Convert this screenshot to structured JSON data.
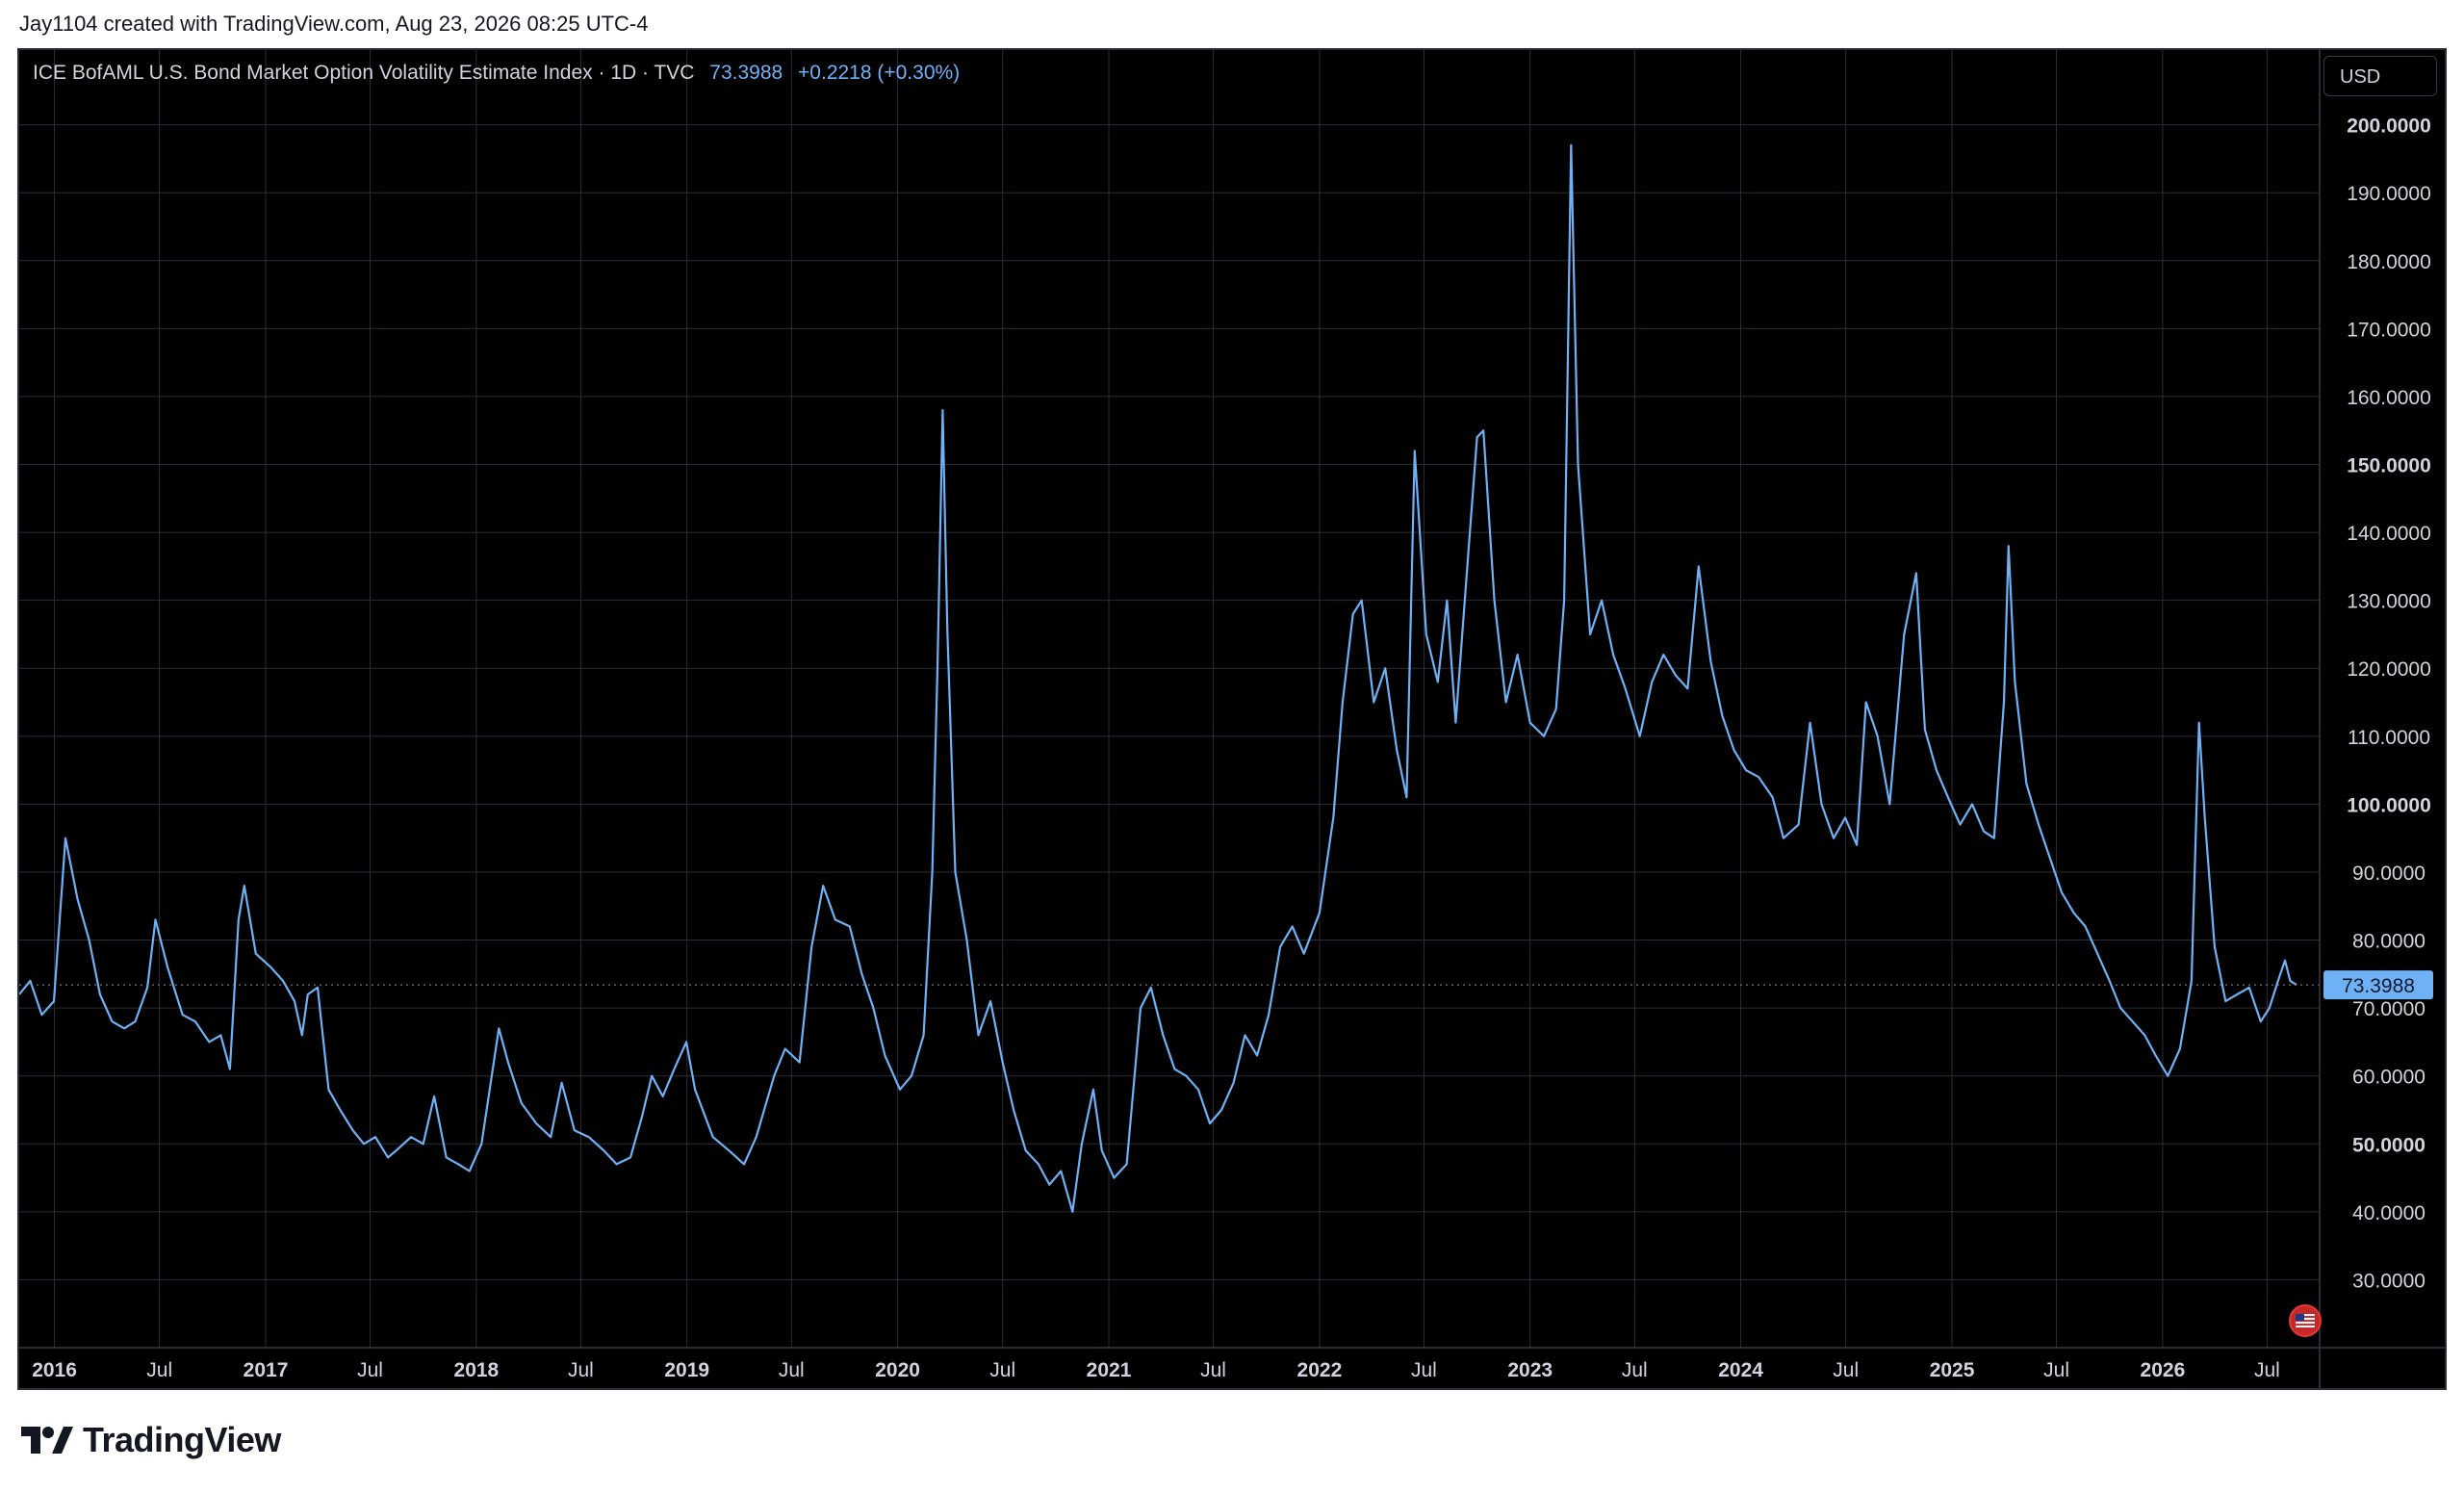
{
  "attribution": "Jay1104 created with TradingView.com, Aug 23, 2026 08:25 UTC-4",
  "legend": {
    "title": "ICE BofAML U.S. Bond Market Option Volatility Estimate Index · 1D · TVC",
    "last": "73.3988",
    "change": "+0.2218 (+0.30%)"
  },
  "currency": "USD",
  "logo": {
    "text": "TradingView"
  },
  "flag_icon": "us-flag-icon",
  "colors": {
    "background": "#000000",
    "line": "#6eb1f5",
    "grid": "#2a2e39",
    "text": "#d1d4dc",
    "price_badge": "#6eb1f5"
  },
  "chart_data": {
    "type": "line",
    "series": [
      {
        "points": [
          [
            "2015-11-01",
            72
          ],
          [
            "2015-11-20",
            74
          ],
          [
            "2015-12-10",
            69
          ],
          [
            "2015-12-31",
            71
          ],
          [
            "2016-01-20",
            95
          ],
          [
            "2016-02-10",
            86
          ],
          [
            "2016-03-01",
            80
          ],
          [
            "2016-03-20",
            72
          ],
          [
            "2016-04-10",
            68
          ],
          [
            "2016-05-01",
            67
          ],
          [
            "2016-05-20",
            68
          ],
          [
            "2016-06-10",
            73
          ],
          [
            "2016-06-24",
            83
          ],
          [
            "2016-07-15",
            76
          ],
          [
            "2016-08-10",
            69
          ],
          [
            "2016-09-01",
            68
          ],
          [
            "2016-09-25",
            65
          ],
          [
            "2016-10-15",
            66
          ],
          [
            "2016-10-31",
            61
          ],
          [
            "2016-11-15",
            83
          ],
          [
            "2016-11-25",
            88
          ],
          [
            "2016-12-15",
            78
          ],
          [
            "2017-01-10",
            76
          ],
          [
            "2017-01-31",
            74
          ],
          [
            "2017-02-20",
            71
          ],
          [
            "2017-03-05",
            66
          ],
          [
            "2017-03-15",
            72
          ],
          [
            "2017-04-01",
            73
          ],
          [
            "2017-04-20",
            58
          ],
          [
            "2017-05-10",
            55
          ],
          [
            "2017-06-01",
            52
          ],
          [
            "2017-06-20",
            50
          ],
          [
            "2017-07-10",
            51
          ],
          [
            "2017-08-01",
            48
          ],
          [
            "2017-08-15",
            49
          ],
          [
            "2017-09-10",
            51
          ],
          [
            "2017-10-01",
            50
          ],
          [
            "2017-10-20",
            57
          ],
          [
            "2017-11-10",
            48
          ],
          [
            "2017-12-01",
            47
          ],
          [
            "2017-12-20",
            46
          ],
          [
            "2018-01-10",
            50
          ],
          [
            "2018-02-09",
            67
          ],
          [
            "2018-02-25",
            62
          ],
          [
            "2018-03-20",
            56
          ],
          [
            "2018-04-15",
            53
          ],
          [
            "2018-05-10",
            51
          ],
          [
            "2018-05-29",
            59
          ],
          [
            "2018-06-20",
            52
          ],
          [
            "2018-07-15",
            51
          ],
          [
            "2018-08-10",
            49
          ],
          [
            "2018-09-01",
            47
          ],
          [
            "2018-09-25",
            48
          ],
          [
            "2018-10-15",
            54
          ],
          [
            "2018-11-01",
            60
          ],
          [
            "2018-11-20",
            57
          ],
          [
            "2018-12-10",
            61
          ],
          [
            "2018-12-31",
            65
          ],
          [
            "2019-01-15",
            58
          ],
          [
            "2019-02-15",
            51
          ],
          [
            "2019-03-15",
            49
          ],
          [
            "2019-04-10",
            47
          ],
          [
            "2019-05-01",
            51
          ],
          [
            "2019-06-01",
            60
          ],
          [
            "2019-06-20",
            64
          ],
          [
            "2019-07-15",
            62
          ],
          [
            "2019-08-05",
            79
          ],
          [
            "2019-08-25",
            88
          ],
          [
            "2019-09-15",
            83
          ],
          [
            "2019-10-10",
            82
          ],
          [
            "2019-10-31",
            75
          ],
          [
            "2019-11-20",
            70
          ],
          [
            "2019-12-10",
            63
          ],
          [
            "2020-01-05",
            58
          ],
          [
            "2020-01-25",
            60
          ],
          [
            "2020-02-15",
            66
          ],
          [
            "2020-03-01",
            90
          ],
          [
            "2020-03-10",
            120
          ],
          [
            "2020-03-19",
            158
          ],
          [
            "2020-03-27",
            126
          ],
          [
            "2020-04-10",
            90
          ],
          [
            "2020-04-30",
            80
          ],
          [
            "2020-05-20",
            66
          ],
          [
            "2020-06-10",
            71
          ],
          [
            "2020-07-01",
            62
          ],
          [
            "2020-07-20",
            55
          ],
          [
            "2020-08-10",
            49
          ],
          [
            "2020-09-01",
            47
          ],
          [
            "2020-09-20",
            44
          ],
          [
            "2020-10-10",
            46
          ],
          [
            "2020-10-30",
            40
          ],
          [
            "2020-11-15",
            50
          ],
          [
            "2020-12-05",
            58
          ],
          [
            "2020-12-20",
            49
          ],
          [
            "2021-01-10",
            45
          ],
          [
            "2021-02-01",
            47
          ],
          [
            "2021-02-25",
            70
          ],
          [
            "2021-03-15",
            73
          ],
          [
            "2021-04-05",
            66
          ],
          [
            "2021-04-25",
            61
          ],
          [
            "2021-05-15",
            60
          ],
          [
            "2021-06-05",
            58
          ],
          [
            "2021-06-25",
            53
          ],
          [
            "2021-07-15",
            55
          ],
          [
            "2021-08-05",
            59
          ],
          [
            "2021-08-25",
            66
          ],
          [
            "2021-09-15",
            63
          ],
          [
            "2021-10-05",
            69
          ],
          [
            "2021-10-25",
            79
          ],
          [
            "2021-11-15",
            82
          ],
          [
            "2021-12-05",
            78
          ],
          [
            "2022-01-01",
            84
          ],
          [
            "2022-01-25",
            98
          ],
          [
            "2022-02-10",
            115
          ],
          [
            "2022-02-28",
            128
          ],
          [
            "2022-03-15",
            130
          ],
          [
            "2022-04-05",
            115
          ],
          [
            "2022-04-25",
            120
          ],
          [
            "2022-05-15",
            108
          ],
          [
            "2022-06-01",
            101
          ],
          [
            "2022-06-15",
            152
          ],
          [
            "2022-07-05",
            125
          ],
          [
            "2022-07-25",
            118
          ],
          [
            "2022-08-10",
            130
          ],
          [
            "2022-08-25",
            112
          ],
          [
            "2022-09-15",
            136
          ],
          [
            "2022-10-01",
            154
          ],
          [
            "2022-10-12",
            155
          ],
          [
            "2022-10-31",
            130
          ],
          [
            "2022-11-20",
            115
          ],
          [
            "2022-12-10",
            122
          ],
          [
            "2023-01-01",
            112
          ],
          [
            "2023-01-25",
            110
          ],
          [
            "2023-02-15",
            114
          ],
          [
            "2023-03-01",
            130
          ],
          [
            "2023-03-13",
            197
          ],
          [
            "2023-03-25",
            150
          ],
          [
            "2023-04-15",
            125
          ],
          [
            "2023-05-05",
            130
          ],
          [
            "2023-05-25",
            122
          ],
          [
            "2023-06-15",
            117
          ],
          [
            "2023-07-10",
            110
          ],
          [
            "2023-07-31",
            118
          ],
          [
            "2023-08-20",
            122
          ],
          [
            "2023-09-10",
            119
          ],
          [
            "2023-10-01",
            117
          ],
          [
            "2023-10-20",
            135
          ],
          [
            "2023-11-10",
            121
          ],
          [
            "2023-11-30",
            113
          ],
          [
            "2023-12-20",
            108
          ],
          [
            "2024-01-10",
            105
          ],
          [
            "2024-02-01",
            104
          ],
          [
            "2024-02-25",
            101
          ],
          [
            "2024-03-15",
            95
          ],
          [
            "2024-04-10",
            97
          ],
          [
            "2024-04-30",
            112
          ],
          [
            "2024-05-20",
            100
          ],
          [
            "2024-06-10",
            95
          ],
          [
            "2024-06-30",
            98
          ],
          [
            "2024-07-20",
            94
          ],
          [
            "2024-08-05",
            115
          ],
          [
            "2024-08-25",
            110
          ],
          [
            "2024-09-15",
            100
          ],
          [
            "2024-10-10",
            125
          ],
          [
            "2024-10-31",
            134
          ],
          [
            "2024-11-15",
            111
          ],
          [
            "2024-12-05",
            105
          ],
          [
            "2024-12-25",
            101
          ],
          [
            "2025-01-15",
            97
          ],
          [
            "2025-02-05",
            100
          ],
          [
            "2025-02-25",
            96
          ],
          [
            "2025-03-15",
            95
          ],
          [
            "2025-04-01",
            115
          ],
          [
            "2025-04-09",
            138
          ],
          [
            "2025-04-20",
            118
          ],
          [
            "2025-05-10",
            103
          ],
          [
            "2025-05-31",
            97
          ],
          [
            "2025-06-20",
            92
          ],
          [
            "2025-07-10",
            87
          ],
          [
            "2025-07-31",
            84
          ],
          [
            "2025-08-20",
            82
          ],
          [
            "2025-09-10",
            78
          ],
          [
            "2025-10-01",
            74
          ],
          [
            "2025-10-20",
            70
          ],
          [
            "2025-11-10",
            68
          ],
          [
            "2025-12-01",
            66
          ],
          [
            "2025-12-20",
            63
          ],
          [
            "2026-01-10",
            60
          ],
          [
            "2026-01-31",
            64
          ],
          [
            "2026-02-20",
            74
          ],
          [
            "2026-03-05",
            112
          ],
          [
            "2026-03-15",
            98
          ],
          [
            "2026-04-01",
            79
          ],
          [
            "2026-04-20",
            71
          ],
          [
            "2026-05-10",
            72
          ],
          [
            "2026-05-31",
            73
          ],
          [
            "2026-06-20",
            68
          ],
          [
            "2026-07-05",
            70
          ],
          [
            "2026-07-20",
            74
          ],
          [
            "2026-08-01",
            77
          ],
          [
            "2026-08-10",
            74
          ],
          [
            "2026-08-21",
            73.3988
          ]
        ]
      }
    ],
    "x_range": [
      "2015-11-01",
      "2026-09-30"
    ],
    "x_ticks": [
      {
        "date": "2016-01-01",
        "label": "2016",
        "major": true
      },
      {
        "date": "2016-07-01",
        "label": "Jul",
        "major": false
      },
      {
        "date": "2017-01-01",
        "label": "2017",
        "major": true
      },
      {
        "date": "2017-07-01",
        "label": "Jul",
        "major": false
      },
      {
        "date": "2018-01-01",
        "label": "2018",
        "major": true
      },
      {
        "date": "2018-07-01",
        "label": "Jul",
        "major": false
      },
      {
        "date": "2019-01-01",
        "label": "2019",
        "major": true
      },
      {
        "date": "2019-07-01",
        "label": "Jul",
        "major": false
      },
      {
        "date": "2020-01-01",
        "label": "2020",
        "major": true
      },
      {
        "date": "2020-07-01",
        "label": "Jul",
        "major": false
      },
      {
        "date": "2021-01-01",
        "label": "2021",
        "major": true
      },
      {
        "date": "2021-07-01",
        "label": "Jul",
        "major": false
      },
      {
        "date": "2022-01-01",
        "label": "2022",
        "major": true
      },
      {
        "date": "2022-07-01",
        "label": "Jul",
        "major": false
      },
      {
        "date": "2023-01-01",
        "label": "2023",
        "major": true
      },
      {
        "date": "2023-07-01",
        "label": "Jul",
        "major": false
      },
      {
        "date": "2024-01-01",
        "label": "2024",
        "major": true
      },
      {
        "date": "2024-07-01",
        "label": "Jul",
        "major": false
      },
      {
        "date": "2025-01-01",
        "label": "2025",
        "major": true
      },
      {
        "date": "2025-07-01",
        "label": "Jul",
        "major": false
      },
      {
        "date": "2026-01-01",
        "label": "2026",
        "major": true
      },
      {
        "date": "2026-07-01",
        "label": "Jul",
        "major": false
      }
    ],
    "y_range": [
      20,
      211
    ],
    "y_ticks": [
      {
        "value": 30,
        "label": "30.0000",
        "bold": false
      },
      {
        "value": 40,
        "label": "40.0000",
        "bold": false
      },
      {
        "value": 50,
        "label": "50.0000",
        "bold": true
      },
      {
        "value": 60,
        "label": "60.0000",
        "bold": false
      },
      {
        "value": 70,
        "label": "70.0000",
        "bold": false
      },
      {
        "value": 80,
        "label": "80.0000",
        "bold": false
      },
      {
        "value": 90,
        "label": "90.0000",
        "bold": false
      },
      {
        "value": 100,
        "label": "100.0000",
        "bold": true
      },
      {
        "value": 110,
        "label": "110.0000",
        "bold": false
      },
      {
        "value": 120,
        "label": "120.0000",
        "bold": false
      },
      {
        "value": 130,
        "label": "130.0000",
        "bold": false
      },
      {
        "value": 140,
        "label": "140.0000",
        "bold": false
      },
      {
        "value": 150,
        "label": "150.0000",
        "bold": true
      },
      {
        "value": 160,
        "label": "160.0000",
        "bold": false
      },
      {
        "value": 170,
        "label": "170.0000",
        "bold": false
      },
      {
        "value": 180,
        "label": "180.0000",
        "bold": false
      },
      {
        "value": 190,
        "label": "190.0000",
        "bold": false
      },
      {
        "value": 200,
        "label": "200.0000",
        "bold": true
      }
    ],
    "last_value": 73.3988,
    "last_label": "73.3988",
    "grid": true
  }
}
